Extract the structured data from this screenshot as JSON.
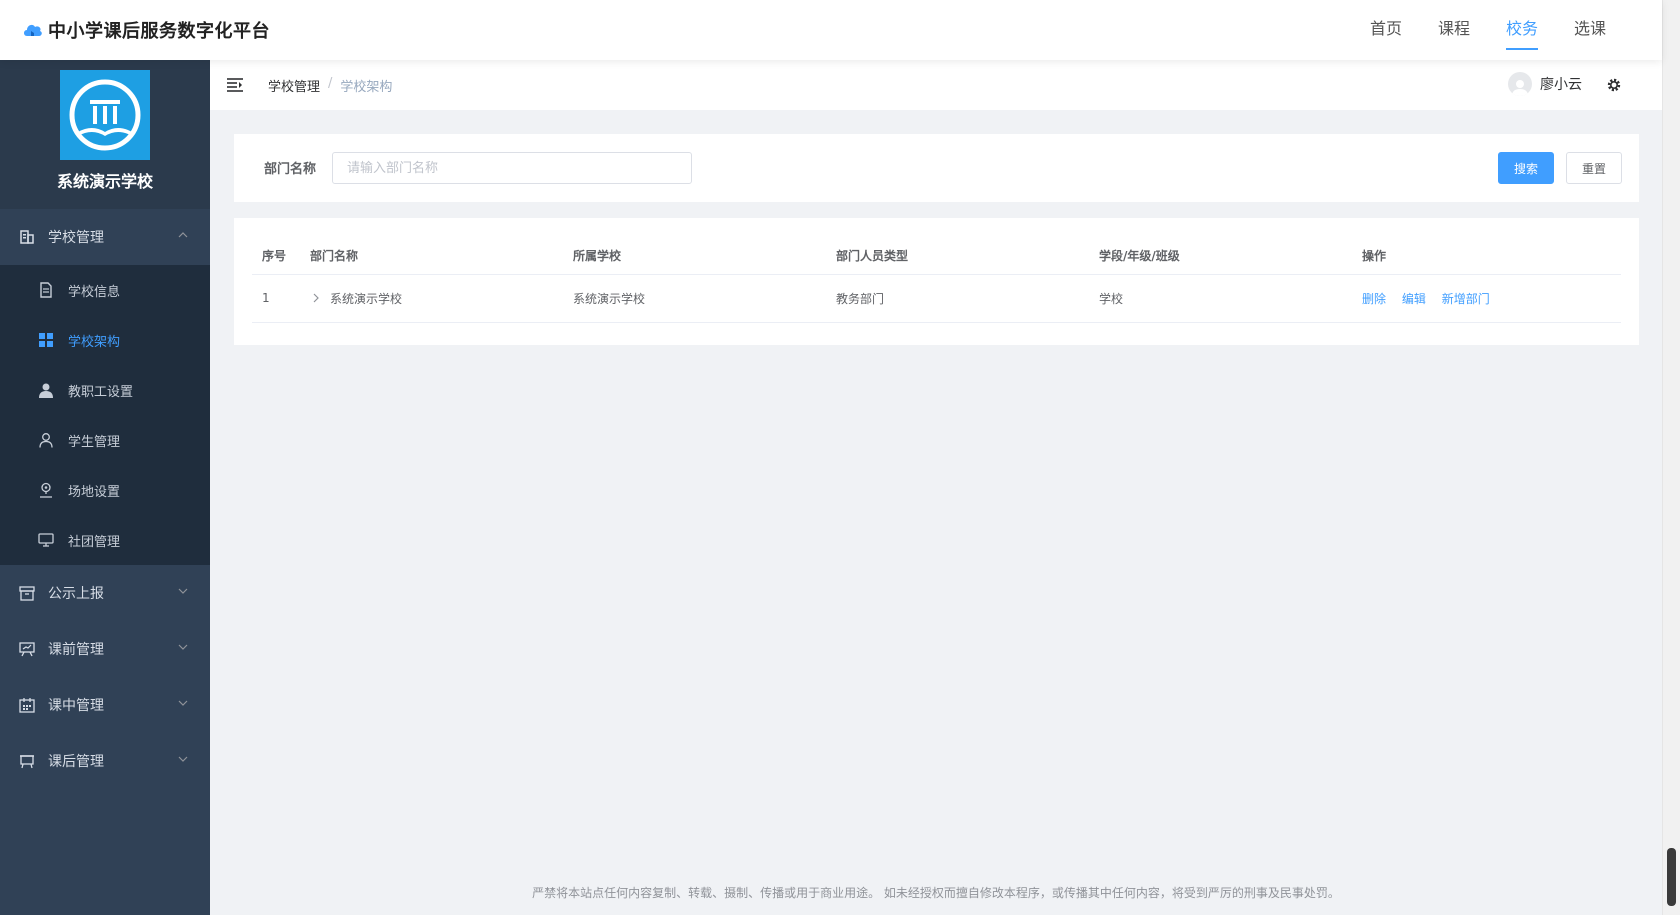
{
  "app": {
    "title": "中小学课后服务数字化平台",
    "nav": [
      "首页",
      "课程",
      "校务",
      "选课"
    ],
    "active_nav": "校务"
  },
  "sidebar": {
    "school_name": "系统演示学校",
    "groups": [
      {
        "label": "学校管理",
        "icon": "building-icon",
        "expanded": true,
        "items": [
          {
            "label": "学校信息",
            "icon": "document-icon"
          },
          {
            "label": "学校架构",
            "icon": "grid-icon",
            "active": true
          },
          {
            "label": "教职工设置",
            "icon": "user-solid-icon"
          },
          {
            "label": "学生管理",
            "icon": "user-outline-icon"
          },
          {
            "label": "场地设置",
            "icon": "location-icon"
          },
          {
            "label": "社团管理",
            "icon": "monitor-icon"
          }
        ]
      },
      {
        "label": "公示上报",
        "icon": "box-icon"
      },
      {
        "label": "课前管理",
        "icon": "presentation-icon"
      },
      {
        "label": "课中管理",
        "icon": "calendar-icon"
      },
      {
        "label": "课后管理",
        "icon": "board-icon"
      }
    ]
  },
  "breadcrumb": {
    "items": [
      "学校管理",
      "学校架构"
    ],
    "separator": "/"
  },
  "user": {
    "name": "廖小云"
  },
  "search": {
    "label": "部门名称",
    "placeholder": "请输入部门名称",
    "value": "",
    "search_button": "搜索",
    "reset_button": "重置"
  },
  "table": {
    "columns": [
      "序号",
      "部门名称",
      "所属学校",
      "部门人员类型",
      "学段/年级/班级",
      "操作"
    ],
    "rows": [
      {
        "index": "1",
        "department": "系统演示学校",
        "school": "系统演示学校",
        "staff_type": "教务部门",
        "level": "学校",
        "actions": [
          "删除",
          "编辑",
          "新增部门"
        ]
      }
    ]
  },
  "footer": {
    "text": "严禁将本站点任何内容复制、转载、摄制、传播或用于商业用途。 如未经授权而擅自修改本程序，或传播其中任何内容，将受到严厉的刑事及民事处罚。"
  },
  "colors": {
    "primary": "#409eff",
    "sidebar_bg": "#304156",
    "submenu_bg": "#1f2d3d",
    "school_logo_bg": "#1e9fe3"
  }
}
